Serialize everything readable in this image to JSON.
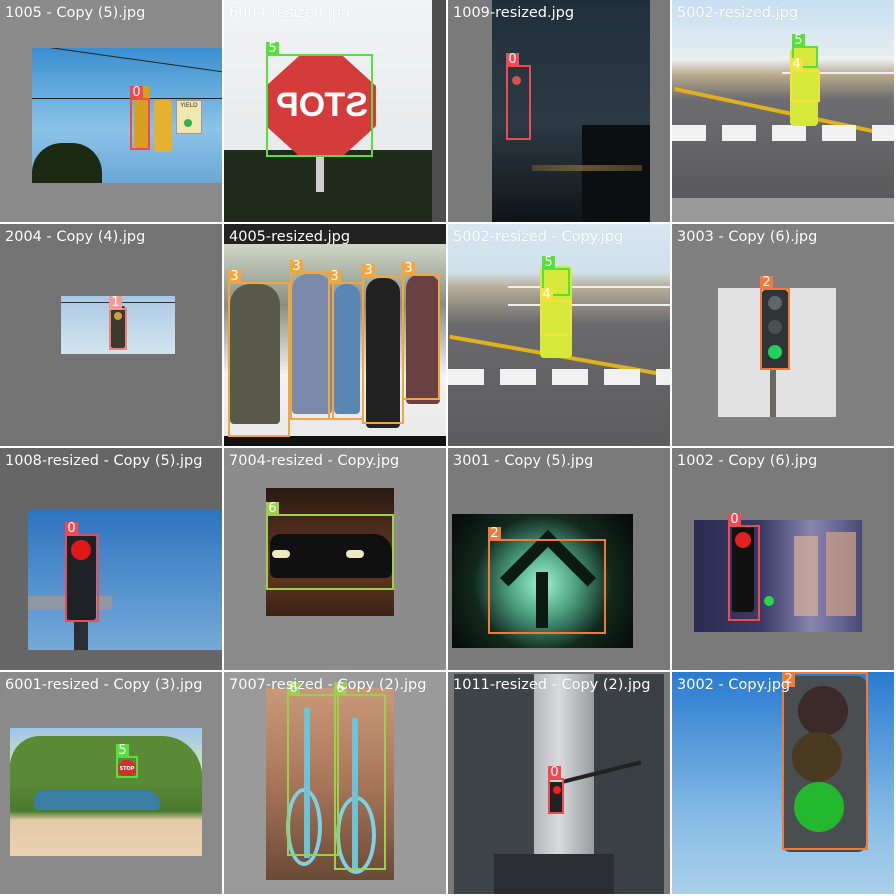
{
  "tiles": [
    {
      "filename": "1005 - Copy (5).jpg",
      "labels": [
        "0"
      ]
    },
    {
      "filename": "6004-resized.jpg",
      "labels": [
        "5"
      ]
    },
    {
      "filename": "1009-resized.jpg",
      "labels": [
        "0"
      ]
    },
    {
      "filename": "5002-resized.jpg",
      "labels": [
        "5",
        "4"
      ]
    },
    {
      "filename": "2004 - Copy (4).jpg",
      "labels": [
        "1"
      ]
    },
    {
      "filename": "4005-resized.jpg",
      "labels": [
        "3",
        "3",
        "3",
        "3",
        "3"
      ]
    },
    {
      "filename": "5002-resized - Copy.jpg",
      "labels": [
        "5",
        "4"
      ]
    },
    {
      "filename": "3003 - Copy (6).jpg",
      "labels": [
        "2"
      ]
    },
    {
      "filename": "1008-resized - Copy (5).jpg",
      "labels": [
        "0"
      ]
    },
    {
      "filename": "7004-resized - Copy.jpg",
      "labels": [
        "6"
      ]
    },
    {
      "filename": "3001 - Copy (5).jpg",
      "labels": [
        "2"
      ]
    },
    {
      "filename": "1002 - Copy (6).jpg",
      "labels": [
        "0"
      ]
    },
    {
      "filename": "6001-resized - Copy (3).jpg",
      "labels": [
        "5"
      ]
    },
    {
      "filename": "7007-resized - Copy (2).jpg",
      "labels": [
        "6",
        "6"
      ]
    },
    {
      "filename": "1011-resized - Copy (2).jpg",
      "labels": [
        "0"
      ]
    },
    {
      "filename": "3002 - Copy.jpg",
      "labels": [
        "2"
      ]
    }
  ],
  "sign_text": {
    "stop": "STOP",
    "stop_mirrored": "STOP",
    "yield": "YIELD"
  },
  "colors": {
    "class_0": "#ef4a52",
    "class_1": "#f39a9a",
    "class_2": "#f07a3a",
    "class_3": "#f3a640",
    "class_4": "#f6e23e",
    "class_5": "#55e03b",
    "class_6": "#9bd04a"
  }
}
